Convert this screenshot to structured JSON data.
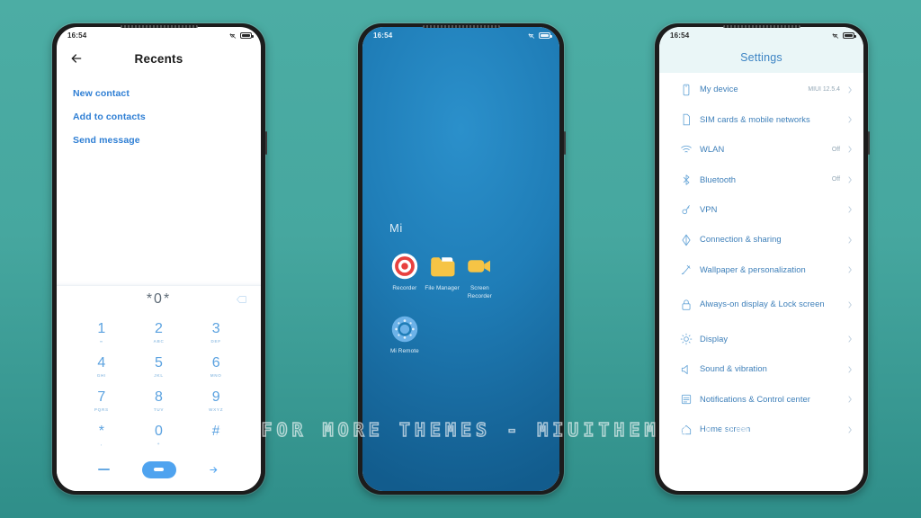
{
  "watermark": "VISIT FOR MORE THEMES - MIUITHEMER.COM",
  "theme": {
    "background_top": "#4cada4",
    "background_bottom": "#2f8e89",
    "accent_blue": "#4fa3ef",
    "settings_blue": "#3d7fb9",
    "wallpaper_blue": "#1f7db7"
  },
  "phone1": {
    "status": {
      "time": "16:54",
      "mute_icon": "mute-icon",
      "battery_icon": "battery-icon"
    },
    "header": {
      "back_icon": "back-arrow-icon",
      "title": "Recents"
    },
    "actions": [
      {
        "label": "New contact",
        "name": "new-contact"
      },
      {
        "label": "Add to contacts",
        "name": "add-to-contacts"
      },
      {
        "label": "Send message",
        "name": "send-message"
      }
    ],
    "dialpad": {
      "display_value": "*0*",
      "backspace_icon": "backspace-icon",
      "keys": [
        {
          "num": "1",
          "sub": "∞"
        },
        {
          "num": "2",
          "sub": "ABC"
        },
        {
          "num": "3",
          "sub": "DEF"
        },
        {
          "num": "4",
          "sub": "GHI"
        },
        {
          "num": "5",
          "sub": "JKL"
        },
        {
          "num": "6",
          "sub": "MNO"
        },
        {
          "num": "7",
          "sub": "PQRS"
        },
        {
          "num": "8",
          "sub": "TUV"
        },
        {
          "num": "9",
          "sub": "WXYZ"
        },
        {
          "num": "*",
          "sub": ","
        },
        {
          "num": "0",
          "sub": "+"
        },
        {
          "num": "#",
          "sub": ""
        }
      ],
      "hide_icon": "hide-keypad-icon",
      "call_icon": "call-button-icon",
      "forward_icon": "arrow-right-icon"
    }
  },
  "phone2": {
    "status": {
      "time": "16:54",
      "mute_icon": "mute-icon",
      "battery_icon": "battery-icon"
    },
    "folder": {
      "title": "Mi",
      "apps": [
        {
          "label": "Recorder",
          "icon": "recorder-icon"
        },
        {
          "label": "File Manager",
          "icon": "file-manager-icon"
        },
        {
          "label": "Screen Recorder",
          "icon": "screen-recorder-icon"
        },
        {
          "label": "Mi Remote",
          "icon": "mi-remote-icon"
        }
      ]
    }
  },
  "phone3": {
    "status": {
      "time": "16:54",
      "mute_icon": "mute-icon",
      "battery_icon": "battery-icon"
    },
    "header": {
      "title": "Settings"
    },
    "items": [
      {
        "label": "My device",
        "value": "MIUI 12.5.4",
        "icon": "device-icon"
      },
      {
        "label": "SIM cards & mobile networks",
        "value": "",
        "icon": "sim-card-icon"
      },
      {
        "label": "WLAN",
        "value": "Off",
        "icon": "wifi-icon"
      },
      {
        "label": "Bluetooth",
        "value": "Off",
        "icon": "bluetooth-icon"
      },
      {
        "label": "VPN",
        "value": "",
        "icon": "vpn-key-icon"
      },
      {
        "label": "Connection & sharing",
        "value": "",
        "icon": "connection-sharing-icon"
      },
      {
        "label": "Wallpaper & personalization",
        "value": "",
        "icon": "wallpaper-icon"
      },
      {
        "label": "Always-on display & Lock screen",
        "value": "",
        "icon": "lock-icon"
      },
      {
        "label": "Display",
        "value": "",
        "icon": "brightness-icon"
      },
      {
        "label": "Sound & vibration",
        "value": "",
        "icon": "speaker-icon"
      },
      {
        "label": "Notifications & Control center",
        "value": "",
        "icon": "notifications-icon"
      },
      {
        "label": "Home screen",
        "value": "",
        "icon": "home-icon"
      }
    ]
  }
}
